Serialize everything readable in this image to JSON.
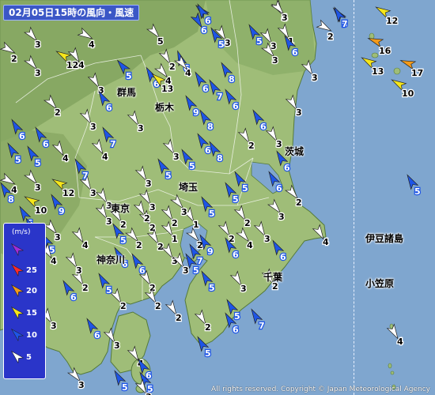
{
  "title": "02月05日15時の風向・風速",
  "copyright": "All rights reserved. Copyright © Japan Meteorological Agency",
  "legend": {
    "unit": "(m/s)",
    "levels": [
      {
        "label": "",
        "color": "#a02cd8"
      },
      {
        "label": "25",
        "color": "#ff2a2a"
      },
      {
        "label": "20",
        "color": "#f39a1a"
      },
      {
        "label": "15",
        "color": "#f5e61a"
      },
      {
        "label": "10",
        "color": "#1e55e6"
      },
      {
        "label": "5",
        "color": "#ffffff"
      }
    ]
  },
  "places": {
    "gunma": "群馬",
    "tochigi": "栃木",
    "ibaraki": "茨城",
    "saitama": "埼玉",
    "tokyo": "東京",
    "kanagawa": "神奈川",
    "chiba": "千葉",
    "izu": "伊豆諸島",
    "ogasawara": "小笠原"
  },
  "colors": {
    "sea": "#7fa6cf",
    "land": "#9fbd78",
    "mountain": "#7e9f5a",
    "white": "#ffffff",
    "blue": "#1e55e6",
    "yellow": "#f5e61a",
    "orange": "#f39a1a"
  },
  "wind_stations": [
    {
      "speed": 6,
      "dir": 135,
      "color": "blue"
    },
    {
      "speed": 4,
      "dir": 330,
      "color": "white"
    },
    {
      "speed": 5,
      "dir": 140,
      "color": "blue"
    },
    {
      "speed": 3,
      "dir": 320,
      "color": "white"
    },
    {
      "speed": 4,
      "dir": 300,
      "color": "white"
    },
    {
      "speed": 5,
      "dir": 320,
      "color": "white"
    },
    {
      "speed": 5,
      "dir": 150,
      "color": "blue"
    },
    {
      "speed": 3,
      "dir": 330,
      "color": "white"
    },
    {
      "speed": 1,
      "dir": 330,
      "color": "white"
    },
    {
      "speed": 2,
      "dir": 300,
      "color": "white"
    },
    {
      "speed": 6,
      "dir": 330,
      "color": "blue"
    },
    {
      "speed": 6,
      "dir": 160,
      "color": "blue"
    },
    {
      "speed": 3,
      "dir": 320,
      "color": "white"
    },
    {
      "speed": 6,
      "dir": 150,
      "color": "blue"
    },
    {
      "speed": 12,
      "dir": 120,
      "color": "yellow"
    },
    {
      "speed": 16,
      "dir": 110,
      "color": "orange"
    },
    {
      "speed": 13,
      "dir": 120,
      "color": "yellow"
    },
    {
      "speed": 17,
      "dir": 110,
      "color": "orange"
    },
    {
      "speed": 10,
      "dir": 120,
      "color": "yellow"
    },
    {
      "speed": 2,
      "dir": 330,
      "color": "white"
    },
    {
      "speed": 4,
      "dir": 320,
      "color": "white"
    },
    {
      "speed": 5,
      "dir": 140,
      "color": "blue"
    },
    {
      "speed": 2,
      "dir": 300,
      "color": "white"
    },
    {
      "speed": 3,
      "dir": 320,
      "color": "white"
    },
    {
      "speed": 4,
      "dir": 330,
      "color": "white"
    },
    {
      "speed": 8,
      "dir": 150,
      "color": "blue"
    },
    {
      "speed": 6,
      "dir": 150,
      "color": "blue"
    },
    {
      "speed": 3,
      "dir": 330,
      "color": "white"
    },
    {
      "speed": 7,
      "dir": 150,
      "color": "blue"
    },
    {
      "speed": 3,
      "dir": 330,
      "color": "white"
    },
    {
      "speed": 2,
      "dir": 320,
      "color": "white"
    },
    {
      "speed": 6,
      "dir": 150,
      "color": "blue"
    },
    {
      "speed": 13,
      "dir": 130,
      "color": "yellow"
    },
    {
      "speed": 4,
      "dir": 320,
      "color": "white"
    },
    {
      "speed": 6,
      "dir": 150,
      "color": "blue"
    },
    {
      "speed": 9,
      "dir": 150,
      "color": "blue"
    },
    {
      "speed": 6,
      "dir": 150,
      "color": "blue"
    },
    {
      "speed": 8,
      "dir": 150,
      "color": "blue"
    },
    {
      "speed": 6,
      "dir": 150,
      "color": "blue"
    },
    {
      "speed": 3,
      "dir": 330,
      "color": "white"
    },
    {
      "speed": 3,
      "dir": 330,
      "color": "white"
    },
    {
      "speed": 7,
      "dir": 150,
      "color": "blue"
    },
    {
      "speed": 2,
      "dir": 330,
      "color": "white"
    },
    {
      "speed": 3,
      "dir": 330,
      "color": "white"
    },
    {
      "speed": 6,
      "dir": 150,
      "color": "blue"
    },
    {
      "speed": 6,
      "dir": 150,
      "color": "blue"
    },
    {
      "speed": 5,
      "dir": 150,
      "color": "blue"
    },
    {
      "speed": 5,
      "dir": 150,
      "color": "blue"
    },
    {
      "speed": 3,
      "dir": 330,
      "color": "white"
    },
    {
      "speed": 4,
      "dir": 330,
      "color": "white"
    },
    {
      "speed": 8,
      "dir": 150,
      "color": "blue"
    },
    {
      "speed": 6,
      "dir": 150,
      "color": "blue"
    },
    {
      "speed": 5,
      "dir": 150,
      "color": "blue"
    },
    {
      "speed": 3,
      "dir": 330,
      "color": "white"
    },
    {
      "speed": 5,
      "dir": 150,
      "color": "blue"
    },
    {
      "speed": 5,
      "dir": 150,
      "color": "blue"
    },
    {
      "speed": 6,
      "dir": 150,
      "color": "blue"
    },
    {
      "speed": 6,
      "dir": 150,
      "color": "blue"
    },
    {
      "speed": 3,
      "dir": 330,
      "color": "white"
    },
    {
      "speed": 5,
      "dir": 150,
      "color": "blue"
    },
    {
      "speed": 3,
      "dir": 330,
      "color": "white"
    },
    {
      "speed": 2,
      "dir": 320,
      "color": "white"
    },
    {
      "speed": 10,
      "dir": 120,
      "color": "yellow"
    },
    {
      "speed": 6,
      "dir": 150,
      "color": "blue"
    },
    {
      "speed": 3,
      "dir": 330,
      "color": "white"
    },
    {
      "speed": 3,
      "dir": 330,
      "color": "white"
    },
    {
      "speed": 2,
      "dir": 330,
      "color": "white"
    },
    {
      "speed": 1,
      "dir": 330,
      "color": "white"
    },
    {
      "speed": 2,
      "dir": 330,
      "color": "white"
    },
    {
      "speed": 2,
      "dir": 330,
      "color": "white"
    },
    {
      "speed": 1,
      "dir": 330,
      "color": "white"
    },
    {
      "speed": 2,
      "dir": 320,
      "color": "white"
    },
    {
      "speed": 2,
      "dir": 330,
      "color": "white"
    },
    {
      "speed": 3,
      "dir": 330,
      "color": "white"
    },
    {
      "speed": 2,
      "dir": 320,
      "color": "white"
    },
    {
      "speed": 2,
      "dir": 330,
      "color": "white"
    },
    {
      "speed": 4,
      "dir": 320,
      "color": "white"
    },
    {
      "speed": 2,
      "dir": 330,
      "color": "white"
    },
    {
      "speed": 3,
      "dir": 320,
      "color": "white"
    },
    {
      "speed": 3,
      "dir": 330,
      "color": "white"
    },
    {
      "speed": 4,
      "dir": 330,
      "color": "white"
    },
    {
      "speed": 2,
      "dir": 330,
      "color": "white"
    },
    {
      "speed": 3,
      "dir": 320,
      "color": "white"
    },
    {
      "speed": 4,
      "dir": 330,
      "color": "white"
    },
    {
      "speed": 7,
      "dir": 150,
      "color": "blue"
    },
    {
      "speed": 3,
      "dir": 330,
      "color": "white"
    },
    {
      "speed": 5,
      "dir": 150,
      "color": "blue"
    },
    {
      "speed": 6,
      "dir": 150,
      "color": "blue"
    },
    {
      "speed": 9,
      "dir": 150,
      "color": "blue"
    },
    {
      "speed": 5,
      "dir": 150,
      "color": "blue"
    },
    {
      "speed": 5,
      "dir": 150,
      "color": "blue"
    },
    {
      "speed": 3,
      "dir": 320,
      "color": "white"
    },
    {
      "speed": 5,
      "dir": 150,
      "color": "blue"
    },
    {
      "speed": 3,
      "dir": 330,
      "color": "white"
    },
    {
      "speed": 6,
      "dir": 150,
      "color": "blue"
    },
    {
      "speed": 2,
      "dir": 330,
      "color": "white"
    },
    {
      "speed": 3,
      "dir": 330,
      "color": "white"
    },
    {
      "speed": 4,
      "dir": 330,
      "color": "white"
    },
    {
      "speed": 6,
      "dir": 150,
      "color": "blue"
    },
    {
      "speed": 2,
      "dir": 330,
      "color": "white"
    },
    {
      "speed": 5,
      "dir": 150,
      "color": "blue"
    },
    {
      "speed": 3,
      "dir": 330,
      "color": "white"
    },
    {
      "speed": 6,
      "dir": 150,
      "color": "blue"
    },
    {
      "speed": 2,
      "dir": 330,
      "color": "white"
    },
    {
      "speed": 3,
      "dir": 330,
      "color": "white"
    },
    {
      "speed": 6,
      "dir": 150,
      "color": "blue"
    },
    {
      "speed": 2,
      "dir": 330,
      "color": "white"
    },
    {
      "speed": 2,
      "dir": 330,
      "color": "white"
    },
    {
      "speed": 5,
      "dir": 150,
      "color": "blue"
    },
    {
      "speed": 7,
      "dir": 150,
      "color": "blue"
    },
    {
      "speed": 2,
      "dir": 330,
      "color": "white"
    },
    {
      "speed": 3,
      "dir": 330,
      "color": "white"
    },
    {
      "speed": 6,
      "dir": 150,
      "color": "blue"
    },
    {
      "speed": 3,
      "dir": 330,
      "color": "white"
    },
    {
      "speed": 4,
      "dir": 330,
      "color": "white"
    },
    {
      "speed": 6,
      "dir": 150,
      "color": "blue"
    },
    {
      "speed": 5,
      "dir": 150,
      "color": "blue"
    },
    {
      "speed": 3,
      "dir": 320,
      "color": "white"
    },
    {
      "speed": 5,
      "dir": 150,
      "color": "blue"
    },
    {
      "speed": 5,
      "dir": 150,
      "color": "blue"
    },
    {
      "speed": 6,
      "dir": 150,
      "color": "blue"
    },
    {
      "speed": 3,
      "dir": 330,
      "color": "white"
    },
    {
      "speed": 5,
      "dir": 150,
      "color": "blue"
    },
    {
      "speed": 4,
      "dir": 330,
      "color": "white"
    },
    {
      "speed": 8,
      "dir": 150,
      "color": "blue"
    },
    {
      "speed": 12,
      "dir": 120,
      "color": "yellow"
    },
    {
      "speed": 3,
      "dir": 320,
      "color": "white"
    },
    {
      "speed": 9,
      "dir": 150,
      "color": "blue"
    },
    {
      "speed": 12,
      "dir": 120,
      "color": "yellow"
    },
    {
      "speed": 9,
      "dir": 150,
      "color": "blue"
    },
    {
      "speed": 7,
      "dir": 150,
      "color": "blue"
    },
    {
      "speed": 5,
      "dir": 150,
      "color": "blue"
    },
    {
      "speed": 3,
      "dir": 330,
      "color": "white"
    },
    {
      "speed": 4,
      "dir": 330,
      "color": "white"
    },
    {
      "speed": 2,
      "dir": 330,
      "color": "white"
    },
    {
      "speed": 3,
      "dir": 330,
      "color": "white"
    },
    {
      "speed": 4,
      "dir": 300,
      "color": "white"
    },
    {
      "speed": 5,
      "dir": 150,
      "color": "blue"
    },
    {
      "speed": 6,
      "dir": 150,
      "color": "blue"
    },
    {
      "speed": 3,
      "dir": 320,
      "color": "white"
    },
    {
      "speed": 7,
      "dir": 150,
      "color": "blue"
    }
  ]
}
